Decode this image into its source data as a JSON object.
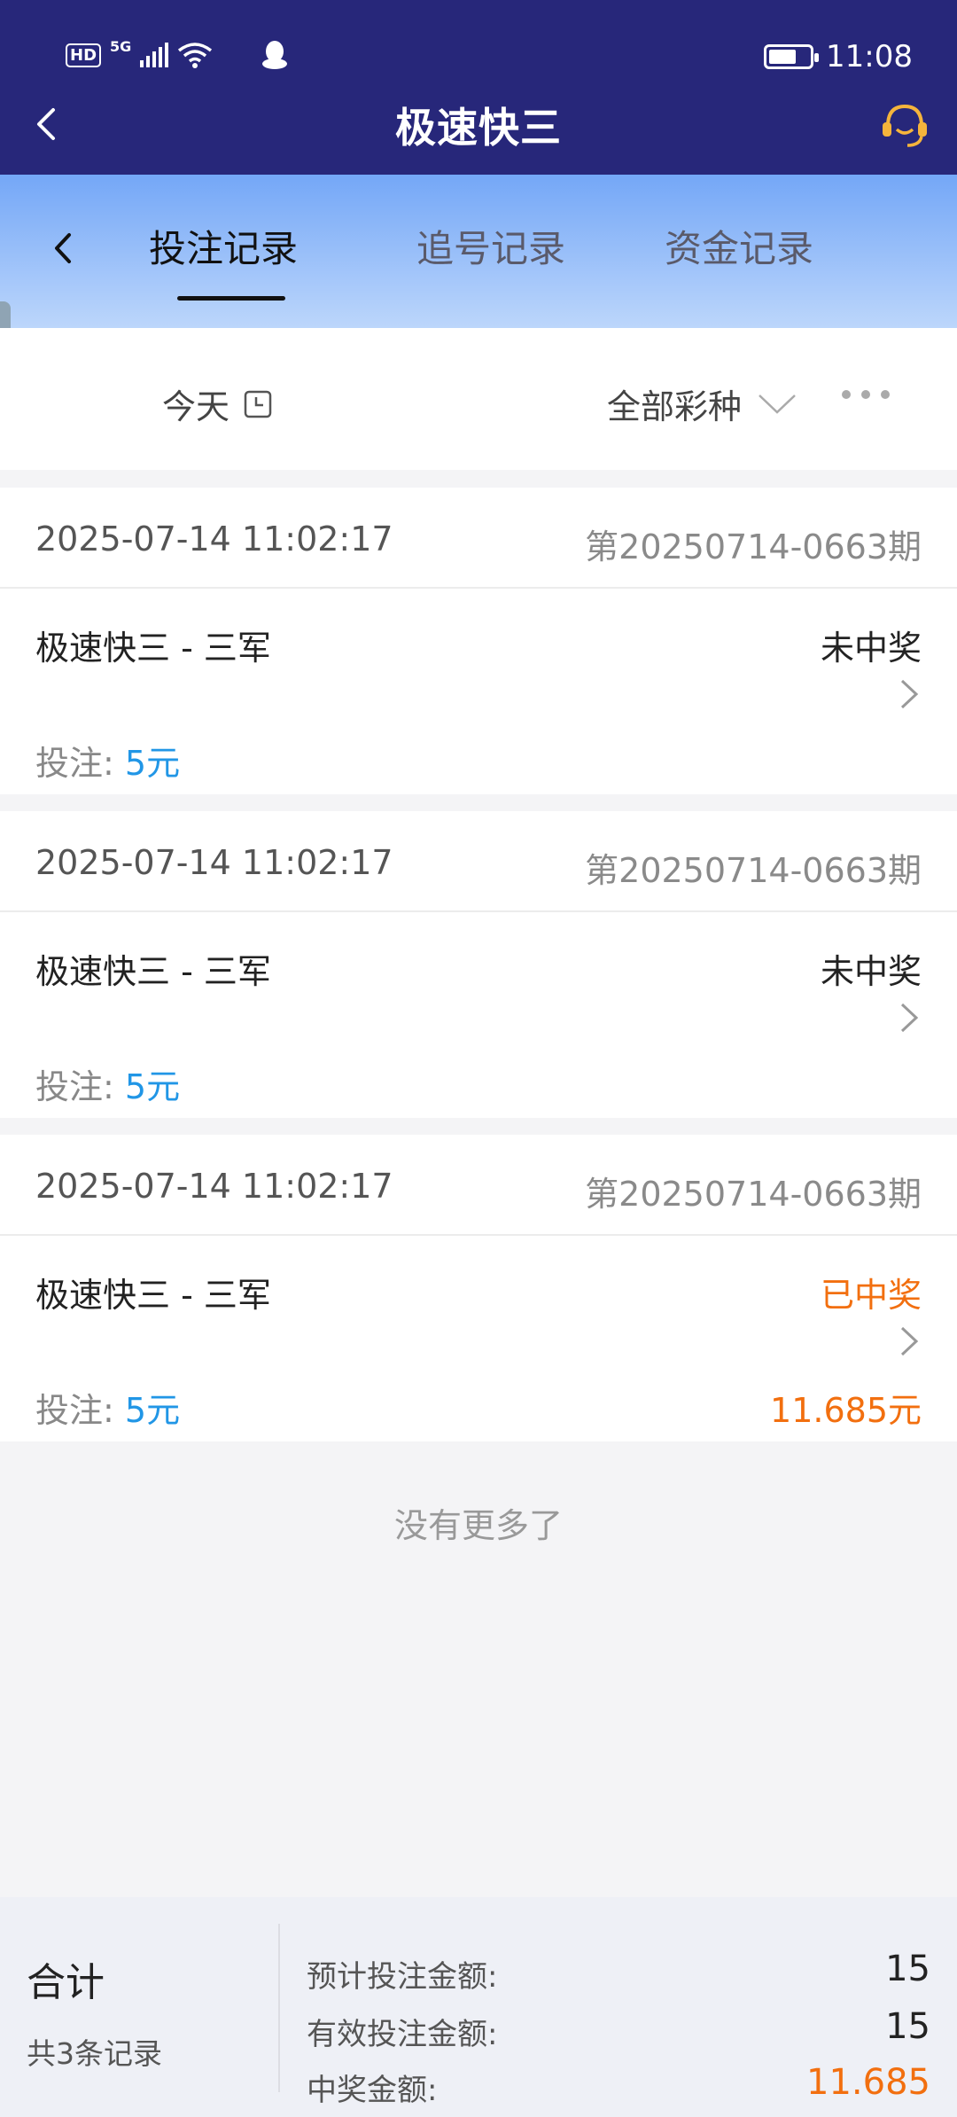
{
  "status_bar": {
    "hd": "HD",
    "network": "5G",
    "time": "11:08"
  },
  "header": {
    "title": "极速快三"
  },
  "tabs": [
    {
      "label": "投注记录",
      "active": true
    },
    {
      "label": "追号记录",
      "active": false
    },
    {
      "label": "资金记录",
      "active": false
    }
  ],
  "filter": {
    "date": "今天",
    "lottery": "全部彩种"
  },
  "records": [
    {
      "time": "2025-07-14 11:02:17",
      "period": "第20250714-0663期",
      "name": "极速快三 - 三军",
      "status": "未中奖",
      "bet_label": "投注:",
      "bet_amount": "5元",
      "win_amount": ""
    },
    {
      "time": "2025-07-14 11:02:17",
      "period": "第20250714-0663期",
      "name": "极速快三 - 三军",
      "status": "未中奖",
      "bet_label": "投注:",
      "bet_amount": "5元",
      "win_amount": ""
    },
    {
      "time": "2025-07-14 11:02:17",
      "period": "第20250714-0663期",
      "name": "极速快三 - 三军",
      "status": "已中奖",
      "bet_label": "投注:",
      "bet_amount": "5元",
      "win_amount": "11.685元"
    }
  ],
  "no_more": "没有更多了",
  "summary": {
    "title": "合计",
    "count": "共3条记录",
    "expected_label": "预计投注金额:",
    "expected_value": "15",
    "valid_label": "有效投注金额:",
    "valid_value": "15",
    "win_label": "中奖金额:",
    "win_value": "11.685"
  },
  "colors": {
    "header_bg": "#27277a",
    "tab_gradient_top": "#74a7f7",
    "tab_gradient_bottom": "#bcd6fb",
    "win": "#f26f0f",
    "bet_amount": "#2196e6"
  }
}
